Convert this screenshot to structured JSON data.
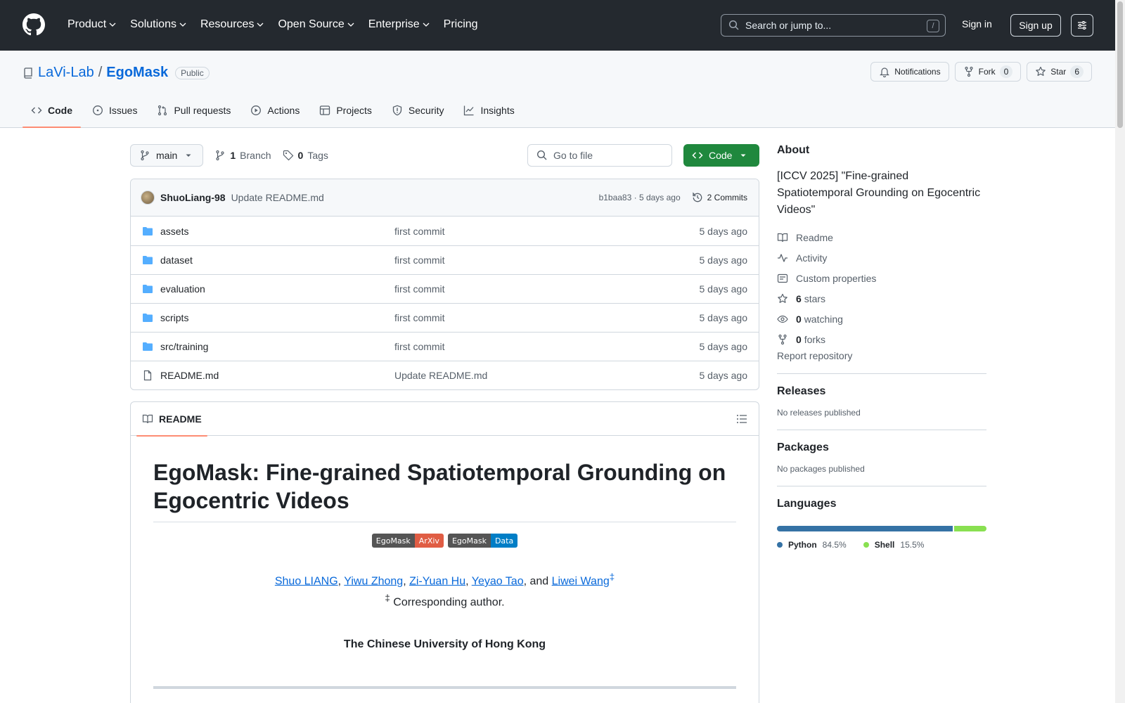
{
  "header": {
    "nav": [
      "Product",
      "Solutions",
      "Resources",
      "Open Source",
      "Enterprise",
      "Pricing"
    ],
    "search_placeholder": "Search or jump to...",
    "slash": "/",
    "sign_in": "Sign in",
    "sign_up": "Sign up"
  },
  "repo": {
    "owner": "LaVi-Lab",
    "sep": "/",
    "name": "EgoMask",
    "visibility": "Public",
    "notifications": "Notifications",
    "fork_label": "Fork",
    "fork_count": "0",
    "star_label": "Star",
    "star_count": "6",
    "tabs": [
      "Code",
      "Issues",
      "Pull requests",
      "Actions",
      "Projects",
      "Security",
      "Insights"
    ]
  },
  "toolbar": {
    "branch": "main",
    "branch_count": "1",
    "branch_label": "Branch",
    "tag_count": "0",
    "tag_label": "Tags",
    "goto_placeholder": "Go to file",
    "code_label": "Code"
  },
  "commit": {
    "author": "ShuoLiang-98",
    "message": "Update README.md",
    "meta": "b1baa83 · 5 days ago",
    "count_label": "2 Commits"
  },
  "files": [
    {
      "type": "dir",
      "name": "assets",
      "commit": "first commit",
      "time": "5 days ago"
    },
    {
      "type": "dir",
      "name": "dataset",
      "commit": "first commit",
      "time": "5 days ago"
    },
    {
      "type": "dir",
      "name": "evaluation",
      "commit": "first commit",
      "time": "5 days ago"
    },
    {
      "type": "dir",
      "name": "scripts",
      "commit": "first commit",
      "time": "5 days ago"
    },
    {
      "type": "dir",
      "name": "src/training",
      "commit": "first commit",
      "time": "5 days ago"
    },
    {
      "type": "file",
      "name": "README.md",
      "commit": "Update README.md",
      "time": "5 days ago"
    }
  ],
  "readme": {
    "tab": "README",
    "title": "EgoMask: Fine-grained Spatiotemporal Grounding on Egocentric Videos",
    "badges": [
      {
        "left": "EgoMask",
        "right": "ArXiv",
        "color": "#e05d44"
      },
      {
        "left": "EgoMask",
        "right": "Data",
        "color": "#007ec6"
      }
    ],
    "authors": [
      "Shuo LIANG",
      "Yiwu Zhong",
      "Zi-Yuan Hu",
      "Yeyao Tao",
      "Liwei Wang"
    ],
    "authors_join": ", ",
    "authors_and": ", and ",
    "dagger": "‡",
    "corresponding": " Corresponding author.",
    "affiliation": "The Chinese University of Hong Kong"
  },
  "sidebar": {
    "about_title": "About",
    "description": "[ICCV 2025] \"Fine-grained Spatiotemporal Grounding on Egocentric Videos\"",
    "readme": "Readme",
    "activity": "Activity",
    "custom_properties": "Custom properties",
    "stars_count": "6",
    "stars_label": "stars",
    "watching_count": "0",
    "watching_label": "watching",
    "forks_count": "0",
    "forks_label": "forks",
    "report": "Report repository",
    "releases_title": "Releases",
    "releases_text": "No releases published",
    "packages_title": "Packages",
    "packages_text": "No packages published",
    "languages_title": "Languages",
    "languages": [
      {
        "name": "Python",
        "percent": "84.5%",
        "value": 84.5,
        "color": "#3572A5"
      },
      {
        "name": "Shell",
        "percent": "15.5%",
        "value": 15.5,
        "color": "#89e051"
      }
    ]
  }
}
